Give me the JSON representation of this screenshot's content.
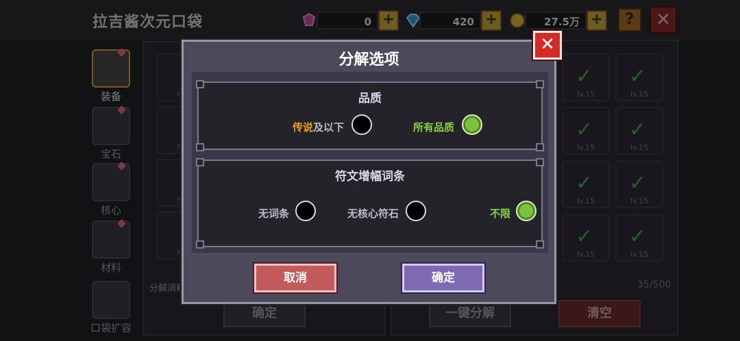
{
  "header": {
    "title": "拉吉酱次元口袋",
    "gem_count": "0",
    "diamond_count": "420",
    "coin_count": "27.5万",
    "help_label": "?",
    "close_label": "✕"
  },
  "sidebar": {
    "items": [
      {
        "label": "装备",
        "icon": "armor-icon",
        "active": true
      },
      {
        "label": "宝石",
        "icon": "gem-icon"
      },
      {
        "label": "核心",
        "icon": "core-icon"
      },
      {
        "label": "材料",
        "icon": "material-icon"
      },
      {
        "label": "口袋扩容",
        "icon": "chest-expand-icon"
      }
    ]
  },
  "inventory": {
    "level_label": "lv.15",
    "slot_level_label_short": "lv",
    "capacity": "35/500",
    "decompose_hint": "分解消耗",
    "confirm_button": "确定",
    "one_key_decompose_button": "一键分解",
    "clear_button": "清空"
  },
  "dialog": {
    "title": "分解选项",
    "close_label": "✕",
    "quality": {
      "title": "品质",
      "option1_highlight": "传说",
      "option1_suffix": "及以下",
      "option1_selected": false,
      "option2_label": "所有品质",
      "option2_selected": true
    },
    "rune": {
      "title": "符文增幅词条",
      "option1_label": "无词条",
      "option1_selected": false,
      "option2_label": "无核心符石",
      "option2_selected": false,
      "option3_label": "不限",
      "option3_selected": true
    },
    "cancel_button": "取消",
    "ok_button": "确定"
  },
  "colors": {
    "legend_orange": "#f0a020",
    "selected_green": "#7cc23e",
    "cancel_red": "#c25a5e",
    "ok_purple": "#7e6ab2",
    "close_red": "#d42a2a"
  }
}
